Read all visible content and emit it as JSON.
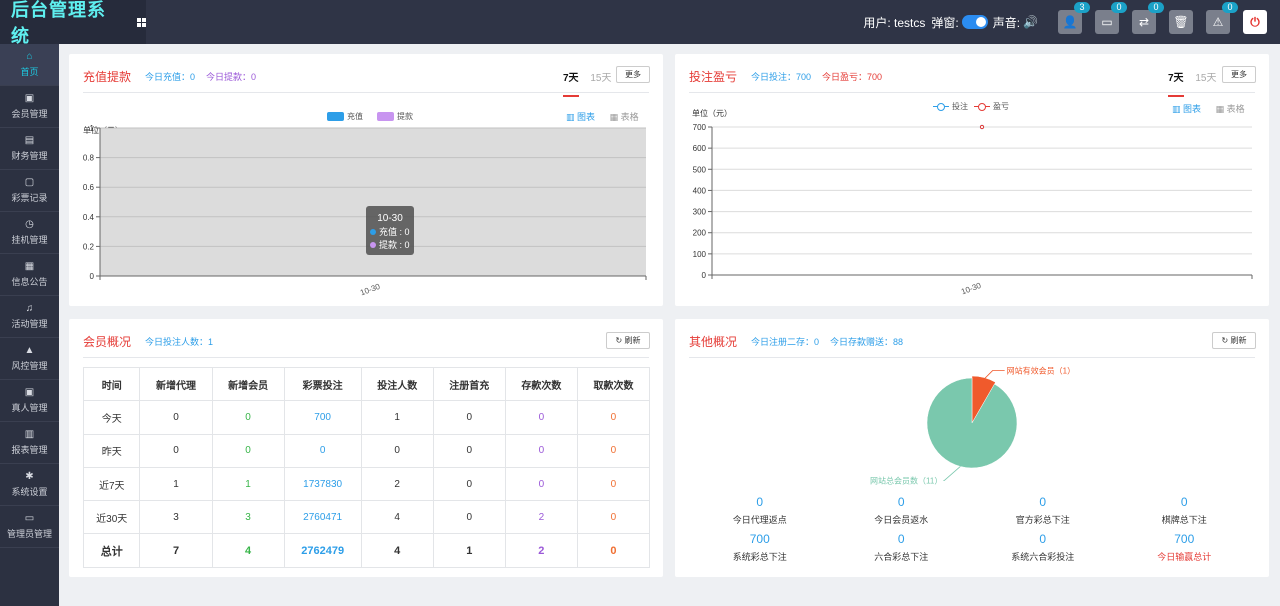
{
  "header": {
    "title": "后台管理系统",
    "user_label": "用户: testcs",
    "popup_label": "弹窗:",
    "sound_label": "声音:",
    "buttons": [
      {
        "name": "user-icon",
        "glyph": "👤",
        "badge": "3"
      },
      {
        "name": "card-icon",
        "glyph": "▭",
        "badge": "0"
      },
      {
        "name": "transfer-icon",
        "glyph": "⇄",
        "badge": "0"
      },
      {
        "name": "trash-icon",
        "glyph": "🗑",
        "badge": ""
      },
      {
        "name": "warning-icon",
        "glyph": "⚠",
        "badge": "0"
      }
    ]
  },
  "sidebar": {
    "items": [
      {
        "label": "首页",
        "icon": "home-icon",
        "glyph": "⌂",
        "active": true
      },
      {
        "label": "会员管理",
        "icon": "member-icon",
        "glyph": "▣"
      },
      {
        "label": "财务管理",
        "icon": "finance-icon",
        "glyph": "▤"
      },
      {
        "label": "彩票记录",
        "icon": "record-icon",
        "glyph": "▢"
      },
      {
        "label": "挂机管理",
        "icon": "clock-icon",
        "glyph": "◷"
      },
      {
        "label": "信息公告",
        "icon": "notice-icon",
        "glyph": "▦"
      },
      {
        "label": "活动管理",
        "icon": "bell-icon",
        "glyph": "♫"
      },
      {
        "label": "风控管理",
        "icon": "warning-icon",
        "glyph": "▲"
      },
      {
        "label": "真人管理",
        "icon": "person-icon",
        "glyph": "▣"
      },
      {
        "label": "报表管理",
        "icon": "report-icon",
        "glyph": "▥"
      },
      {
        "label": "系统设置",
        "icon": "gear-icon",
        "glyph": "✱"
      },
      {
        "label": "管理员管理",
        "icon": "admin-icon",
        "glyph": "▭"
      }
    ]
  },
  "recharge": {
    "title": "充值提款",
    "today_recharge": "今日充值：0",
    "today_withdraw": "今日提款：0",
    "tab_7": "7天",
    "tab_15": "15天",
    "more": "更多",
    "view_chart": "图表",
    "view_table": "表格",
    "unit": "单位（元）",
    "legend_recharge": "充值",
    "legend_withdraw": "提款",
    "tooltip": {
      "title": "10-30",
      "line1": "充值 : 0",
      "line2": "提款 : 0"
    }
  },
  "bet": {
    "title": "投注盈亏",
    "today_bet": "今日投注：700",
    "today_profit": "今日盈亏：700",
    "tab_7": "7天",
    "tab_15": "15天",
    "more": "更多",
    "view_chart": "图表",
    "view_table": "表格",
    "unit": "单位（元）",
    "legend_bet": "投注",
    "legend_profit": "盈亏"
  },
  "chart_data": [
    {
      "type": "bar",
      "categories": [
        "10-30"
      ],
      "series": [
        {
          "name": "充值",
          "values": [
            0
          ]
        },
        {
          "name": "提款",
          "values": [
            0
          ]
        }
      ],
      "ylabel": "单位（元）",
      "ylim": [
        0,
        1
      ],
      "yticks": [
        "0",
        "0.2",
        "0.4",
        "0.6",
        "0.8",
        "1"
      ],
      "colors": [
        "#2d9ee8",
        "#c895f0"
      ]
    },
    {
      "type": "line",
      "categories": [
        "10-30"
      ],
      "series": [
        {
          "name": "投注",
          "values": [
            700
          ]
        },
        {
          "name": "盈亏",
          "values": [
            700
          ]
        }
      ],
      "ylabel": "单位（元）",
      "ylim": [
        0,
        700
      ],
      "yticks": [
        "0",
        "100",
        "200",
        "300",
        "400",
        "500",
        "600",
        "700"
      ],
      "colors": [
        "#2d9ee8",
        "#e53b36"
      ]
    },
    {
      "type": "pie",
      "slices": [
        {
          "label": "网站有效会员（1）",
          "value": 1,
          "color": "#f05a2c"
        },
        {
          "label": "网站总会员数（11）",
          "value": 11,
          "color": "#7ac8ad"
        }
      ]
    }
  ],
  "members": {
    "title": "会员概况",
    "today_bettors": "今日投注人数：1",
    "refresh": "刷新",
    "headers": [
      "时间",
      "新增代理",
      "新增会员",
      "彩票投注",
      "投注人数",
      "注册首充",
      "存款次数",
      "取款次数"
    ],
    "rows": [
      [
        "今天",
        "0",
        "0",
        "700",
        "1",
        "0",
        "0",
        "0"
      ],
      [
        "昨天",
        "0",
        "0",
        "0",
        "0",
        "0",
        "0",
        "0"
      ],
      [
        "近7天",
        "1",
        "1",
        "1737830",
        "2",
        "0",
        "0",
        "0"
      ],
      [
        "近30天",
        "3",
        "3",
        "2760471",
        "4",
        "0",
        "2",
        "0"
      ],
      [
        "总计",
        "7",
        "4",
        "2762479",
        "4",
        "1",
        "2",
        "0"
      ]
    ]
  },
  "other": {
    "title": "其他概况",
    "today_register": "今日注册二存：0",
    "today_deposit_gift": "今日存款赠送：88",
    "refresh": "刷新",
    "stats": [
      {
        "value": "0",
        "label": "今日代理返点"
      },
      {
        "value": "0",
        "label": "今日会员返水"
      },
      {
        "value": "0",
        "label": "官方彩总下注"
      },
      {
        "value": "0",
        "label": "棋牌总下注"
      },
      {
        "value": "700",
        "label": "系统彩总下注"
      },
      {
        "value": "0",
        "label": "六合彩总下注"
      },
      {
        "value": "0",
        "label": "系统六合彩投注"
      },
      {
        "value": "700",
        "label": "今日输赢总计",
        "highlight": true
      }
    ]
  }
}
